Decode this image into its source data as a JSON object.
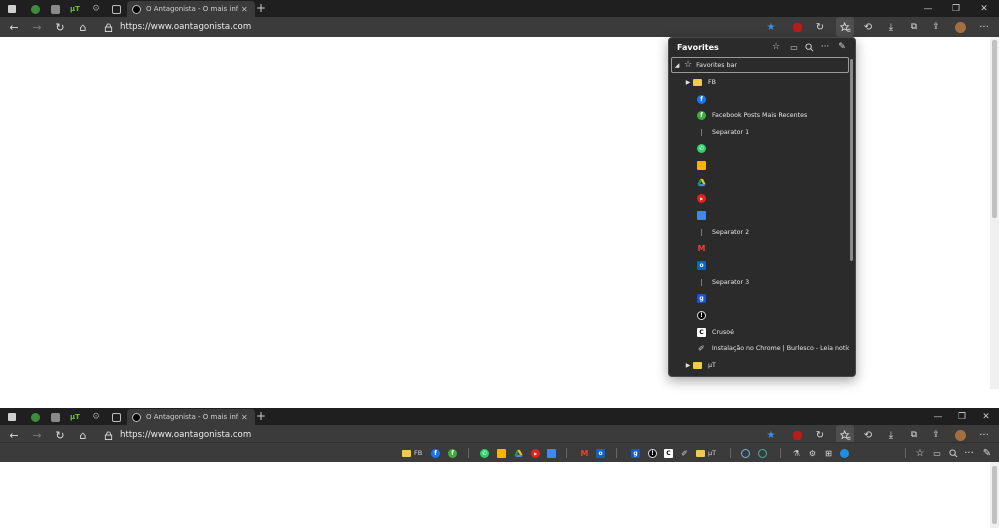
{
  "colors": {
    "chrome_dark": "#1f1f1f",
    "toolbar": "#3b3b3b",
    "panel_bg": "#2b2b2b",
    "star_accent": "#3a8eea",
    "folder": "#f2c94c"
  },
  "browser": {
    "tab_title": "O Antagonista - O mais influente",
    "tab_close_glyph": "✕",
    "new_tab_glyph": "+",
    "url": "https://www.oantagonista.com",
    "window_controls": {
      "minimize": "—",
      "maximize": "❐",
      "close": "✕"
    }
  },
  "icons": {
    "back": "←",
    "forward": "→",
    "refresh": "↻",
    "home": "⌂",
    "star": "★",
    "more": "···"
  },
  "favorites_panel": {
    "title": "Favorites",
    "favorites_bar_label": "Favorites bar",
    "items": [
      {
        "type": "folder",
        "label": "FB"
      },
      {
        "type": "link",
        "label": "",
        "icon": "facebook-icon"
      },
      {
        "type": "link",
        "label": "Facebook Posts Mais Recentes",
        "icon": "facebook-green-icon"
      },
      {
        "type": "separator",
        "label": "Separator 1"
      },
      {
        "type": "link",
        "label": "",
        "icon": "whatsapp-icon"
      },
      {
        "type": "link",
        "label": "",
        "icon": "keep-icon"
      },
      {
        "type": "link",
        "label": "",
        "icon": "drive-icon"
      },
      {
        "type": "link",
        "label": "",
        "icon": "youtube-icon"
      },
      {
        "type": "link",
        "label": "",
        "icon": "translate-icon"
      },
      {
        "type": "separator",
        "label": "Separator 2"
      },
      {
        "type": "link",
        "label": "",
        "icon": "gmail-icon"
      },
      {
        "type": "link",
        "label": "",
        "icon": "outlook-icon"
      },
      {
        "type": "separator",
        "label": "Separator 3"
      },
      {
        "type": "link",
        "label": "",
        "icon": "g-icon"
      },
      {
        "type": "link",
        "label": "",
        "icon": "antagonista-icon"
      },
      {
        "type": "link",
        "label": "Crusoé",
        "icon": "crusoe-icon"
      },
      {
        "type": "link",
        "label": "Instalação no Chrome | Burlesco - Leia notícias s...",
        "icon": "wrench-icon"
      },
      {
        "type": "folder",
        "label": "µT"
      }
    ]
  },
  "favorites_bar": {
    "fb_folder": "FB",
    "ut_folder": "µT"
  }
}
